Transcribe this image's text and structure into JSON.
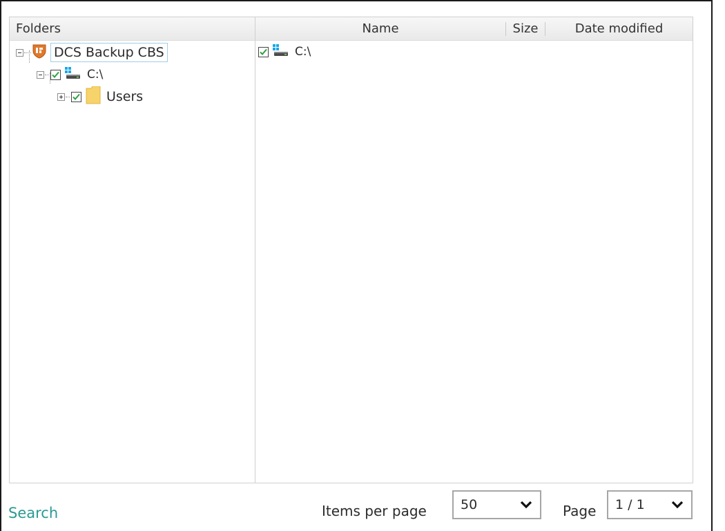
{
  "tree": {
    "header": "Folders",
    "root": {
      "label": "DCS Backup CBS"
    },
    "drive": {
      "label": "C:\\",
      "checked": true
    },
    "folder": {
      "label": "Users",
      "checked": true
    }
  },
  "file_list": {
    "columns": {
      "name": "Name",
      "size": "Size",
      "date": "Date modified"
    },
    "rows": [
      {
        "name": "C:\\",
        "checked": true
      }
    ]
  },
  "footer": {
    "search_label": "Search",
    "items_per_page_label": "Items per page",
    "items_per_page_value": "50",
    "page_label": "Page",
    "page_value": "1 / 1"
  },
  "colors": {
    "search_link": "#2a9a92",
    "check_green": "#2ea043",
    "shield_orange": "#e0782a",
    "folder_yellow": "#f7d36b",
    "selection_border": "#9ed0e6"
  }
}
